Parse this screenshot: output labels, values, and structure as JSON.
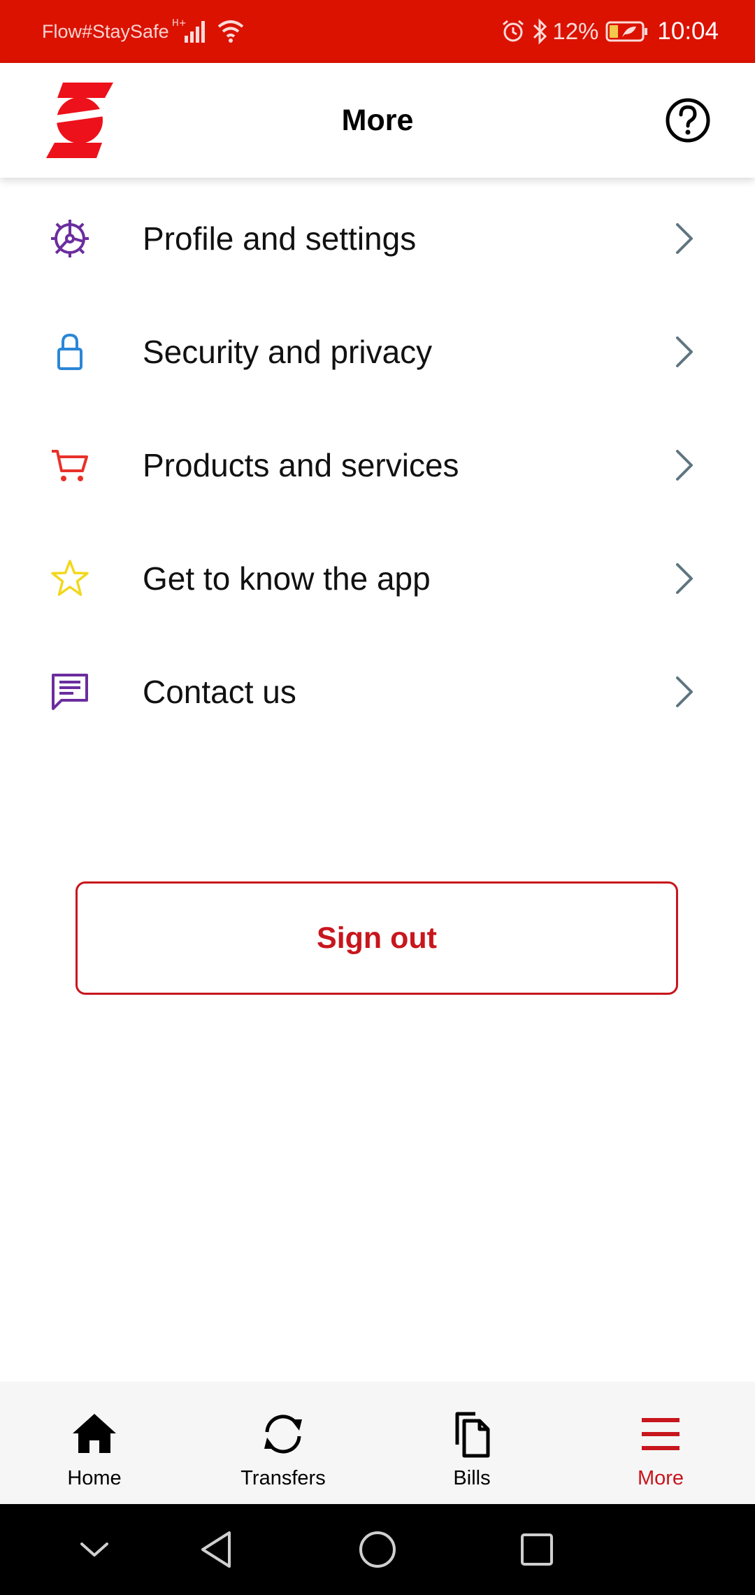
{
  "status_bar": {
    "carrier": "Flow#StaySafe",
    "network_type": "H⁺",
    "battery": "12%",
    "time": "10:04"
  },
  "app_bar": {
    "title": "More",
    "logo_icon": "scotiabank-logo",
    "help_icon": "help-circle-icon"
  },
  "menu": {
    "items": [
      {
        "label": "Profile and settings",
        "icon": "gear-icon",
        "color": "#6b2d9e"
      },
      {
        "label": "Security and privacy",
        "icon": "lock-icon",
        "color": "#2a86d8"
      },
      {
        "label": "Products and services",
        "icon": "cart-icon",
        "color": "#e8312a"
      },
      {
        "label": "Get to know the app",
        "icon": "star-icon",
        "color": "#f2d81e"
      },
      {
        "label": "Contact us",
        "icon": "chat-icon",
        "color": "#6b2d9e"
      }
    ]
  },
  "sign_out_label": "Sign out",
  "bottom_nav": {
    "items": [
      {
        "label": "Home",
        "icon": "home-icon"
      },
      {
        "label": "Transfers",
        "icon": "transfers-icon"
      },
      {
        "label": "Bills",
        "icon": "bills-icon"
      },
      {
        "label": "More",
        "icon": "hamburger-icon",
        "active": true
      }
    ]
  },
  "colors": {
    "brand_red": "#db1200",
    "accent_red": "#c8161d",
    "chevron": "#5f7580"
  }
}
